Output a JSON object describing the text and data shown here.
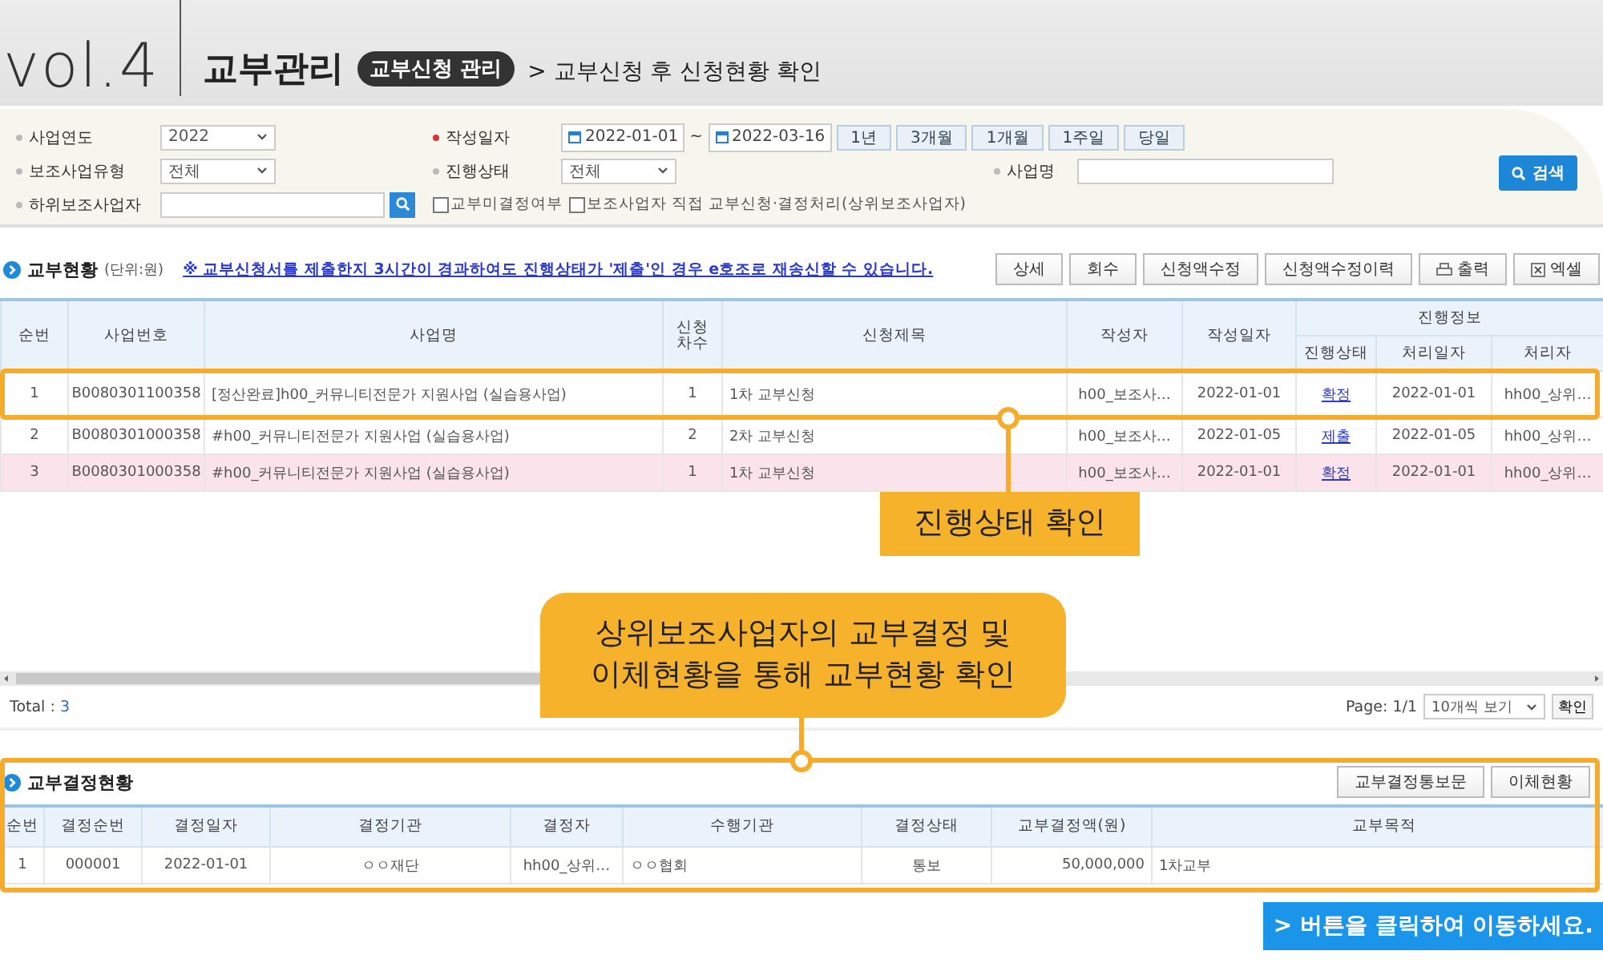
{
  "header": {
    "vol": "vol.4",
    "title": "교부관리",
    "badge": "교부신청 관리",
    "subtitle": "> 교부신청 후 신청현황 확인"
  },
  "filters": {
    "year": {
      "label": "사업연도",
      "value": "2022"
    },
    "type": {
      "label": "보조사업유형",
      "value": "전체"
    },
    "sub": {
      "label": "하위보조사업자"
    },
    "date": {
      "label": "작성일자",
      "required": true,
      "from": "2022-01-01",
      "sep": "~",
      "to": "2022-03-16"
    },
    "periods": [
      "1년",
      "3개월",
      "1개월",
      "1주일",
      "당일"
    ],
    "status": {
      "label": "진행상태",
      "value": "전체"
    },
    "name": {
      "label": "사업명"
    },
    "checks": [
      {
        "label": "교부미결정여부",
        "checked": false
      },
      {
        "label": "보조사업자 직접 교부신청·결정처리(상위보조사업자)",
        "checked": false
      }
    ],
    "search_button": "검색"
  },
  "grants": {
    "title": "교부현황",
    "unit": "(단위:원)",
    "notice": "※ 교부신청서를 제출한지 3시간이 경과하여도 진행상태가 '제출'인 경우 e호조로 재송신할 수 있습니다.",
    "buttons": [
      {
        "label": "상세",
        "kind": "plain"
      },
      {
        "label": "회수",
        "kind": "plain"
      },
      {
        "label": "신청액수정",
        "kind": "plain"
      },
      {
        "label": "신청액수정이력",
        "kind": "plain"
      },
      {
        "label": "출력",
        "kind": "print"
      },
      {
        "label": "엑셀",
        "kind": "excel"
      }
    ],
    "columns": [
      "순번",
      "사업번호",
      "사업명",
      "신청\n차수",
      "신청제목",
      "작성자",
      "작성일자"
    ],
    "group": {
      "label": "진행정보",
      "columns": [
        "진행상태",
        "처리일자",
        "처리자"
      ]
    },
    "rows": [
      {
        "no": "1",
        "biz_no": "B0080301100358",
        "biz_name": "[정산완료]h00_커뮤니티전문가 지원사업 (실습용사업)",
        "round": "1",
        "title": "1차 교부신청",
        "writer": "h00_보조사…",
        "date": "2022-01-01",
        "status": "확정",
        "proc_date": "2022-01-01",
        "processor": "hh00_상위…",
        "selected": false
      },
      {
        "no": "2",
        "biz_no": "B0080301000358",
        "biz_name": "#h00_커뮤니티전문가 지원사업 (실습용사업)",
        "round": "2",
        "title": "2차 교부신청",
        "writer": "h00_보조사…",
        "date": "2022-01-05",
        "status": "제출",
        "proc_date": "2022-01-05",
        "processor": "hh00_상위…",
        "selected": false
      },
      {
        "no": "3",
        "biz_no": "B0080301000358",
        "biz_name": "#h00_커뮤니티전문가 지원사업 (실습용사업)",
        "round": "1",
        "title": "1차 교부신청",
        "writer": "h00_보조사…",
        "date": "2022-01-01",
        "status": "확정",
        "proc_date": "2022-01-01",
        "processor": "hh00_상위…",
        "selected": true
      }
    ],
    "total_label": "Total :",
    "total": "3",
    "page": "Page: 1/1",
    "page_size": "10개씩 보기",
    "confirm": "확인"
  },
  "decisions": {
    "title": "교부결정현황",
    "buttons": [
      "교부결정통보문",
      "이체현황"
    ],
    "columns": [
      "순번",
      "결정순번",
      "결정일자",
      "결정기관",
      "결정자",
      "수행기관",
      "결정상태",
      "교부결정액(원)",
      "교부목적"
    ],
    "rows": [
      [
        "1",
        "000001",
        "2022-01-01",
        "ㅇㅇ재단",
        "hh00_상위…",
        "ㅇㅇ협회",
        "통보",
        "50,000,000",
        "1차교부"
      ]
    ]
  },
  "callouts": [
    {
      "text": "진행상태 확인"
    },
    {
      "text": "상위보조사업자의 교부결정 및\n이체현황을 통해 교부현황 확인"
    }
  ],
  "banner": "> 버튼을 클릭하여 이동하세요."
}
